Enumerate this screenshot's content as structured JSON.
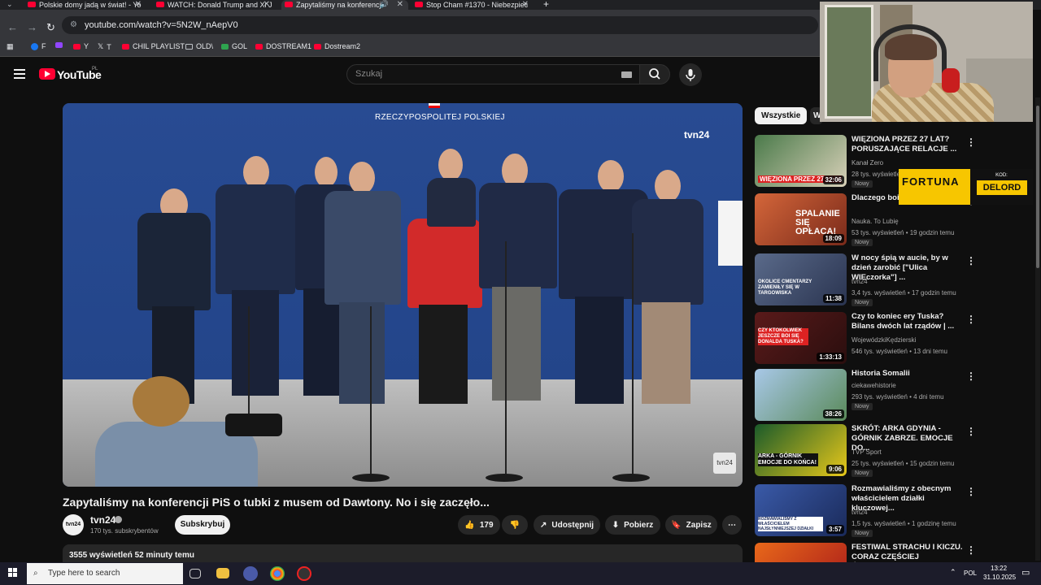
{
  "browser": {
    "tabs": [
      {
        "label": "Polskie domy jadą w świat! - Yo",
        "active": false
      },
      {
        "label": "WATCH: Donald Trump and Xi J",
        "active": false
      },
      {
        "label": "Zapytaliśmy na konferencji",
        "active": true
      },
      {
        "label": "Stop Cham #1370 - Niebezpiec",
        "active": false
      }
    ],
    "url": "youtube.com/watch?v=5N2W_nAepV0",
    "bookmarks": [
      "F",
      "Y",
      "T",
      "CHIL PLAYLIST",
      "OLD\\",
      "GOL",
      "DOSTREAM1",
      "Dostream2"
    ]
  },
  "youtube": {
    "logo_text": "YouTube",
    "region": "PL",
    "search_placeholder": "Szukaj"
  },
  "video": {
    "overlay_banner": "RZECZYPOSPOLITEJ POLSKIEJ",
    "overlay_brand": "tvn24",
    "title": "Zapytaliśmy na konferencji PiS o tubki z musem od Dawtony. No i się zaczęło...",
    "channel": {
      "name": "tvn24",
      "avatar_text": "tvn24",
      "subscribers": "170 tys. subskrybentów",
      "subscribe_label": "Subskrybuj"
    },
    "actions": {
      "likes": "179",
      "share": "Udostępnij",
      "download": "Pobierz",
      "save": "Zapisz"
    },
    "description": "3555 wyświetleń  52 minuty temu"
  },
  "sidebar": {
    "chips": [
      "Wszystkie",
      "W"
    ],
    "recommendations": [
      {
        "title": "WIĘZIONA PRZEZ 27 LAT? PORUSZAJĄCE RELACJE ...",
        "channel": "Kanał Zero",
        "meta": "28 tys. wyświetleń",
        "badge": "Nowy",
        "duration": "32:06",
        "thumb_text": "WIĘZIONA PRZEZ 27 LAT!",
        "thumb_color": "#3a6a3a"
      },
      {
        "title": "Dlaczego boin... śmieci?",
        "channel": "Nauka. To Lubię",
        "meta": "53 tys. wyświetleń • 19 godzin temu",
        "badge": "Nowy",
        "duration": "18:09",
        "thumb_text": "SPALANIE SIĘ OPŁACA!",
        "thumb_color": "#c24a2a"
      },
      {
        "title": "W nocy śpią w aucie, by w dzień zarobić [\"Ulica WIEczorka\"] ...",
        "channel": "tvn24",
        "meta": "3,4 tys. wyświetleń • 17 godzin temu",
        "badge": "Nowy",
        "duration": "11:38",
        "thumb_text": "OKOLICE CMENTARZY ZAMIENIŁY SIĘ W TARGOWISKA",
        "thumb_color": "#3a4a6a"
      },
      {
        "title": "Czy to koniec ery Tuska? Bilans dwóch lat rządów | ...",
        "channel": "WojewódzkiKędzierski",
        "meta": "546 tys. wyświetleń • 13 dni temu",
        "badge": "",
        "duration": "1:33:13",
        "thumb_text": "CZY KTOKOLWIEK JESZCZE BOI SIĘ DONALDA TUSKA?",
        "thumb_color": "#4a1a1a"
      },
      {
        "title": "Historia Somalii",
        "channel": "ciekawehistorie",
        "meta": "293 tys. wyświetleń • 4 dni temu",
        "badge": "Nowy",
        "duration": "38:26",
        "thumb_text": "",
        "thumb_color": "#6a8aa8"
      },
      {
        "title": "SKRÓT: ARKA GDYNIA - GÓRNIK ZABRZE. EMOCJE DO...",
        "channel": "TVP Sport",
        "meta": "25 tys. wyświetleń • 15 godzin temu",
        "badge": "Nowy",
        "duration": "9:06",
        "thumb_text": "ARKA - GÓRNIK EMOCJE DO KOŃCA!",
        "thumb_color": "#2a6a3a"
      },
      {
        "title": "Rozmawialiśmy z obecnym właścicielem działki kluczowej...",
        "channel": "tvn24",
        "meta": "1,5 tys. wyświetleń • 1 godzinę temu",
        "badge": "Nowy",
        "duration": "3:57",
        "thumb_text": "ROZMAWIALIŚMY Z WŁAŚCICIELEM NAJSŁYNNIEJSZEJ DZIAŁKI",
        "thumb_color": "#2a4a8a"
      },
      {
        "title": "FESTIWAL STRACHU I KICZU. CORAZ CZĘŚCIEJ ŚWIĘTUJE...",
        "channel": "",
        "meta": "",
        "badge": "",
        "duration": "",
        "thumb_text": "",
        "thumb_color": "#c8581a"
      }
    ]
  },
  "ad": {
    "brand": "FORTUNA",
    "code_label": "KOD:",
    "code": "DELORD"
  },
  "taskbar": {
    "search_placeholder": "Type here to search",
    "language": "POL",
    "time": "13:22",
    "date": "31.10.2025"
  },
  "colors": {
    "background": "#0f0f0f",
    "youtube_red": "#ff0033",
    "ad_yellow": "#f7c600"
  }
}
